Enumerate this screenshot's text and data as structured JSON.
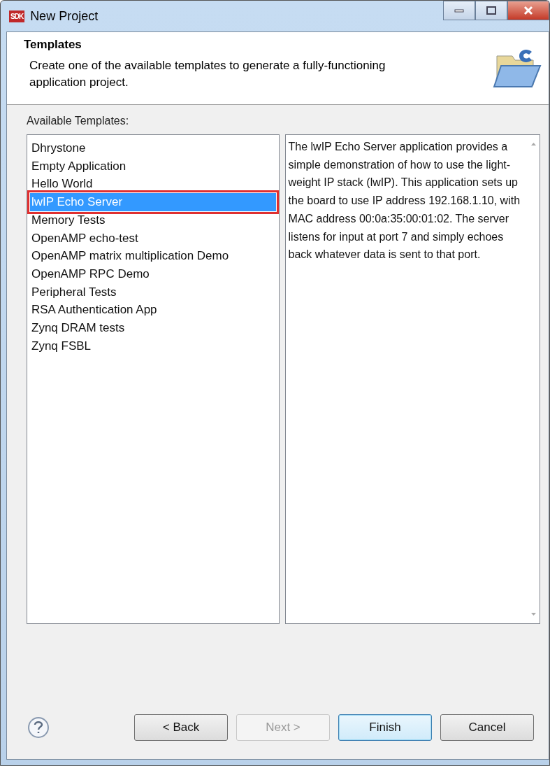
{
  "window": {
    "title": "New Project",
    "icon_text": "SDK"
  },
  "header": {
    "title": "Templates",
    "description": "Create one of the available templates to generate a fully-functioning application project."
  },
  "templates": {
    "label": "Available Templates:",
    "items": [
      {
        "label": "Dhrystone",
        "selected": false
      },
      {
        "label": "Empty Application",
        "selected": false
      },
      {
        "label": "Hello World",
        "selected": false
      },
      {
        "label": "lwIP Echo Server",
        "selected": true
      },
      {
        "label": "Memory Tests",
        "selected": false
      },
      {
        "label": "OpenAMP echo-test",
        "selected": false
      },
      {
        "label": "OpenAMP matrix multiplication Demo",
        "selected": false
      },
      {
        "label": "OpenAMP RPC Demo",
        "selected": false
      },
      {
        "label": "Peripheral Tests",
        "selected": false
      },
      {
        "label": "RSA Authentication App",
        "selected": false
      },
      {
        "label": "Zynq DRAM tests",
        "selected": false
      },
      {
        "label": "Zynq FSBL",
        "selected": false
      }
    ]
  },
  "description": "The lwIP Echo Server application provides a simple demonstration of how to use the light-weight IP stack (lwIP). This application sets up the board to use IP address 192.168.1.10, with MAC address 00:0a:35:00:01:02. The server listens for input at port 7 and simply echoes back whatever data is sent to that port.",
  "buttons": [
    {
      "label": "< Back",
      "disabled": false,
      "default": false
    },
    {
      "label": "Next >",
      "disabled": true,
      "default": false
    },
    {
      "label": "Finish",
      "disabled": false,
      "default": true
    },
    {
      "label": "Cancel",
      "disabled": false,
      "default": false
    }
  ]
}
